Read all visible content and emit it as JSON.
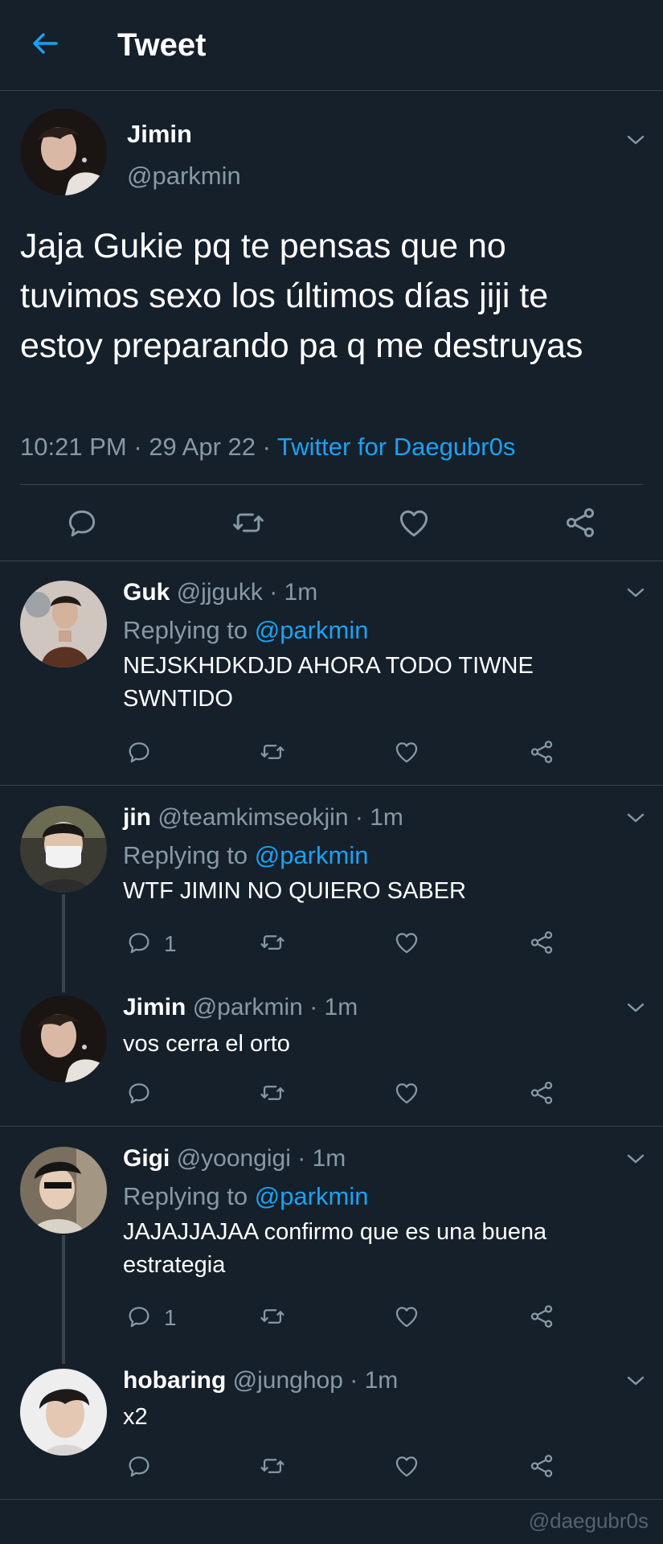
{
  "header": {
    "title": "Tweet",
    "back_icon": "arrow-left-icon",
    "accent": "#1da1f2"
  },
  "main_tweet": {
    "name": "Jimin",
    "handle": "@parkmin",
    "text": "Jaja Gukie pq te pensas que no tuvimos sexo los últimos días jiji te estoy preparando pa q me destruyas",
    "time": "10:21 PM",
    "date": "29 Apr 22",
    "source": "Twitter for Daegubr0s"
  },
  "replies": [
    {
      "name": "Guk",
      "handle": "@jjgukk",
      "time": "1m",
      "replying_prefix": "Replying to",
      "replying_to": "@parkmin",
      "text": "NEJSKHDKDJD AHORA TODO TIWNE SWNTIDO",
      "reply_count": ""
    },
    {
      "name": "jin",
      "handle": "@teamkimseokjin",
      "time": "1m",
      "replying_prefix": "Replying to",
      "replying_to": "@parkmin",
      "text": "WTF JIMIN NO QUIERO SABER",
      "reply_count": "1"
    },
    {
      "name": "Jimin",
      "handle": "@parkmin",
      "time": "1m",
      "text": "vos cerra el orto",
      "reply_count": ""
    },
    {
      "name": "Gigi",
      "handle": "@yoongigi",
      "time": "1m",
      "replying_prefix": "Replying to",
      "replying_to": "@parkmin",
      "text": "JAJAJJAJAA confirmo que es una buena estrategia",
      "reply_count": "1"
    },
    {
      "name": "hobaring",
      "handle": "@junghop",
      "time": "1m",
      "text": "x2",
      "reply_count": ""
    }
  ],
  "dot": "·",
  "watermark": "@daegubr0s",
  "icons": [
    "reply-icon",
    "retweet-icon",
    "like-icon",
    "share-icon",
    "chevron-down-icon"
  ]
}
